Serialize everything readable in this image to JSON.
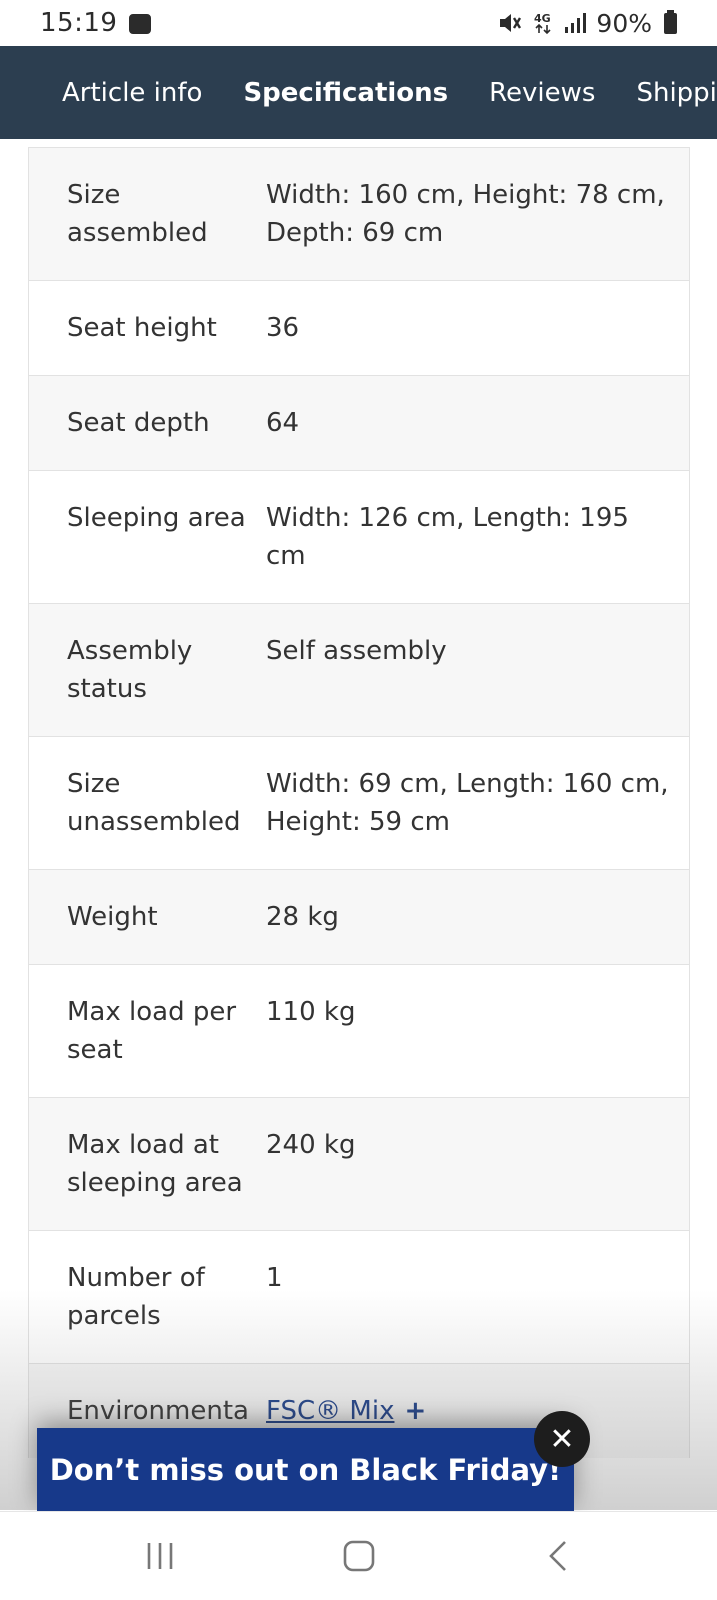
{
  "status_bar": {
    "time": "15:19",
    "battery": "90%",
    "network": "4G"
  },
  "tabs": [
    {
      "label": "Article info",
      "active": false
    },
    {
      "label": "Specifications",
      "active": true
    },
    {
      "label": "Reviews",
      "active": false
    },
    {
      "label": "Shipping",
      "active": false
    }
  ],
  "specs": [
    {
      "label": "Size assembled",
      "value": "Width: 160 cm, Height: 78 cm, Depth: 69 cm"
    },
    {
      "label": "Seat height",
      "value": "36"
    },
    {
      "label": "Seat depth",
      "value": "64"
    },
    {
      "label": "Sleeping area",
      "value": "Width: 126 cm, Length: 195 cm"
    },
    {
      "label": "Assembly status",
      "value": "Self assembly"
    },
    {
      "label": "Size unassembled",
      "value": "Width: 69 cm, Length: 160 cm, Height: 59 cm"
    },
    {
      "label": "Weight",
      "value": "28 kg"
    },
    {
      "label": "Max load per seat",
      "value": "110 kg"
    },
    {
      "label": "Max load at sleeping area",
      "value": "240 kg"
    },
    {
      "label": "Number of parcels",
      "value": "1"
    },
    {
      "label": "Environmenta",
      "link": "FSC® Mix",
      "plus": "+"
    }
  ],
  "promo": {
    "text": "Don’t miss out on Black Friday!",
    "close": "✕"
  },
  "colors": {
    "header_bg": "#2c3e50",
    "promo_bg": "#17398a",
    "link": "#1b3f8b",
    "row_shaded": "#f7f7f7"
  }
}
